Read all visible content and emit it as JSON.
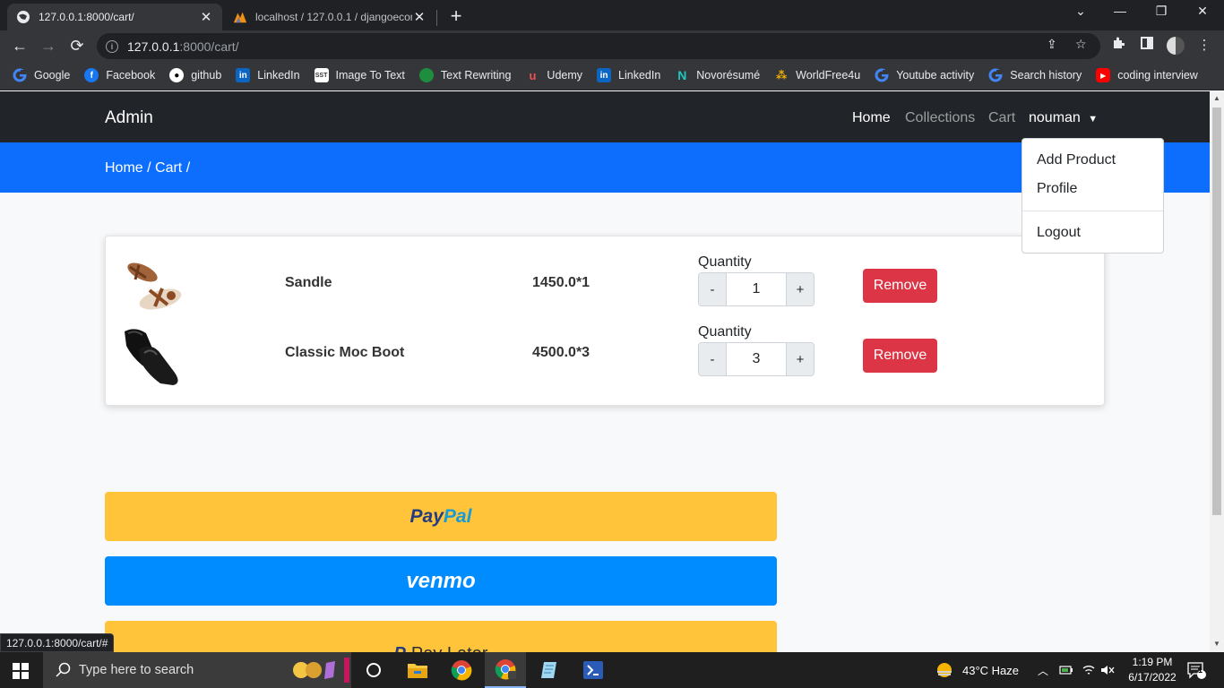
{
  "browser": {
    "tabs": [
      {
        "title": "127.0.0.1:8000/cart/",
        "active": true
      },
      {
        "title": "localhost / 127.0.0.1 / djangoecom",
        "active": false
      }
    ],
    "url_host": "127.0.0.1",
    "url_rest": ":8000/cart/",
    "bookmarks": [
      {
        "label": "Google",
        "icon": "google-icon",
        "color": "#4285f4"
      },
      {
        "label": "Facebook",
        "icon": "facebook-icon",
        "color": "#1877f2"
      },
      {
        "label": "github",
        "icon": "github-icon",
        "color": "#ffffff"
      },
      {
        "label": "LinkedIn",
        "icon": "linkedin-icon",
        "color": "#0a66c2"
      },
      {
        "label": "Image To Text",
        "icon": "sst-icon",
        "color": "#ffffff"
      },
      {
        "label": "Text Rewriting",
        "icon": "leaf-icon",
        "color": "#1e8e3e"
      },
      {
        "label": "Udemy",
        "icon": "udemy-icon",
        "color": "#ec5252"
      },
      {
        "label": "LinkedIn",
        "icon": "linkedin-icon",
        "color": "#0a66c2"
      },
      {
        "label": "Novorésumé",
        "icon": "novoresume-icon",
        "color": "#1fc7c0"
      },
      {
        "label": "WorldFree4u",
        "icon": "worldfree-icon",
        "color": "#f4b400"
      },
      {
        "label": "Youtube activity",
        "icon": "google-icon",
        "color": "#4285f4"
      },
      {
        "label": "Search history",
        "icon": "google-icon",
        "color": "#4285f4"
      },
      {
        "label": "coding interview",
        "icon": "youtube-icon",
        "color": "#ff0000"
      }
    ],
    "status_url": "127.0.0.1:8000/cart/#"
  },
  "navbar": {
    "brand": "Admin",
    "links": [
      {
        "label": "Home",
        "active": true
      },
      {
        "label": "Collections",
        "active": false
      },
      {
        "label": "Cart",
        "active": false
      }
    ],
    "user": "nouman"
  },
  "dropdown": {
    "items": [
      "Add Product",
      "Profile",
      "Logout"
    ]
  },
  "breadcrumb": "Home / Cart /",
  "cart": {
    "quantity_label": "Quantity",
    "remove_label": "Remove",
    "minus_label": "-",
    "plus_label": "+",
    "items": [
      {
        "name": "Sandle",
        "price": "1450.0*1",
        "qty": "1",
        "image": "sandal"
      },
      {
        "name": "Classic Moc Boot",
        "price": "4500.0*3",
        "qty": "3",
        "image": "boot"
      }
    ]
  },
  "payment": {
    "paypal_a": "Pay",
    "paypal_b": "Pal",
    "venmo": "venmo",
    "paylater_logo": "P",
    "paylater": "Pay Later"
  },
  "taskbar": {
    "search_placeholder": "Type here to search",
    "weather": "43°C  Haze",
    "time": "1:19 PM",
    "date": "6/17/2022",
    "notifications": "1"
  },
  "colors": {
    "navbar": "#212529",
    "accent": "#0d6efd",
    "danger": "#dc3545",
    "paypal": "#ffc439",
    "venmo": "#008cff"
  }
}
